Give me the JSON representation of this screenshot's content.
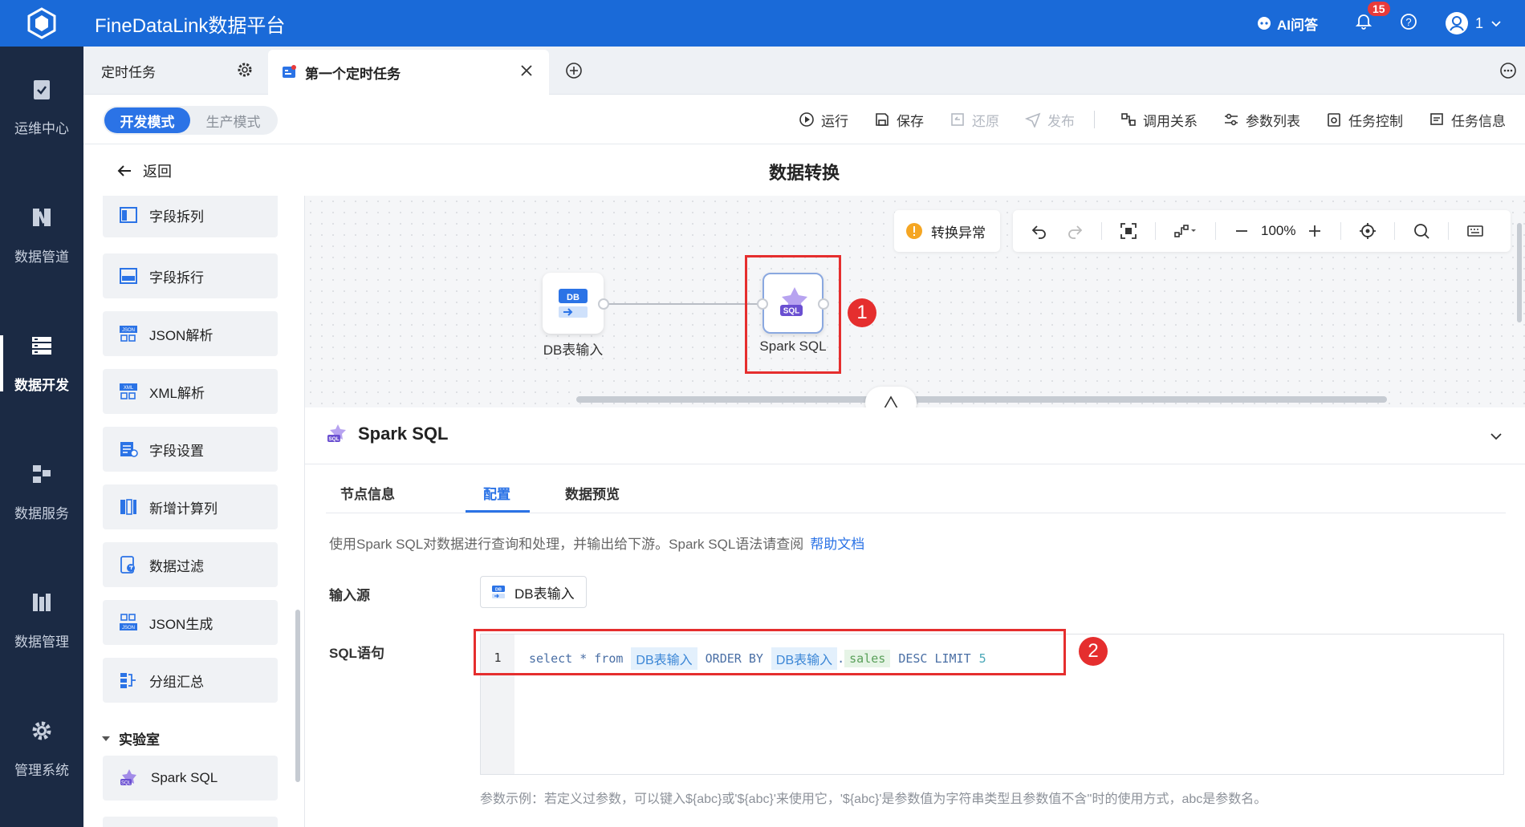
{
  "app": {
    "title": "FineDataLink数据平台"
  },
  "topbar": {
    "ai_label": "AI问答",
    "notif_count": "15",
    "user_label": "1"
  },
  "leftnav": {
    "items": [
      {
        "label": "运维中心",
        "icon": "clipboard-check-icon"
      },
      {
        "label": "数据管道",
        "icon": "pipeline-icon"
      },
      {
        "label": "数据开发",
        "icon": "dev-stack-icon",
        "active": true
      },
      {
        "label": "数据服务",
        "icon": "service-icon"
      },
      {
        "label": "数据管理",
        "icon": "management-icon"
      },
      {
        "label": "管理系统",
        "icon": "gear-icon"
      }
    ]
  },
  "tabs": {
    "scheduled": "定时任务",
    "current": "第一个定时任务"
  },
  "toolbar": {
    "mode_dev": "开发模式",
    "mode_prod": "生产模式",
    "run": "运行",
    "save": "保存",
    "restore": "还原",
    "publish": "发布",
    "call_relation": "调用关系",
    "param_list": "参数列表",
    "task_control": "任务控制",
    "task_info": "任务信息"
  },
  "titlerow": {
    "back": "返回",
    "title": "数据转换"
  },
  "components": {
    "items": [
      "字段拆列",
      "字段拆行",
      "JSON解析",
      "XML解析",
      "字段设置",
      "新增计算列",
      "数据过滤",
      "JSON生成",
      "分组汇总"
    ],
    "lab_header": "实验室",
    "lab_items": [
      "Spark SQL"
    ]
  },
  "canvas": {
    "status": "转换异常",
    "zoom": "100%",
    "nodes": [
      {
        "label": "DB表输入"
      },
      {
        "label": "Spark SQL"
      }
    ],
    "badge1": "1"
  },
  "detail": {
    "title": "Spark SQL",
    "tabs": [
      "节点信息",
      "配置",
      "数据预览"
    ],
    "active_tab": "配置",
    "description": "使用Spark SQL对数据进行查询和处理，并输出给下游。Spark SQL语法请查阅",
    "help_link": "帮助文档",
    "input_label": "输入源",
    "input_value": "DB表输入",
    "sql_label": "SQL语句",
    "sql": {
      "line_no": "1",
      "kw1": "select * from",
      "tbl1": "DB表输入",
      "kw2": "ORDER BY",
      "tbl2": "DB表输入",
      "dot": ".",
      "col": "sales",
      "kw3": "DESC LIMIT",
      "num": "5"
    },
    "badge2": "2",
    "hint": "参数示例：若定义过参数，可以键入${abc}或'${abc}'来使用它，'${abc}'是参数值为字符串类型且参数值不含''时的使用方式，abc是参数名。"
  }
}
